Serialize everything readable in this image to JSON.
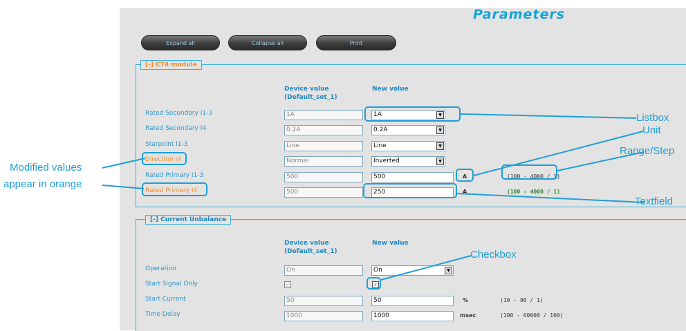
{
  "page": {
    "title": "Parameters"
  },
  "toolbar": {
    "expand_label": "Expand all",
    "collapse_label": "Collapse all",
    "print_label": "Print"
  },
  "sections": [
    {
      "legend": "[-] CT4 module",
      "headers": {
        "device": "Device value\n(Default_set_1)",
        "new": "New value"
      },
      "rows": [
        {
          "label": "Rated Secondary I1-3",
          "device": "1A",
          "new": "1A",
          "type": "select"
        },
        {
          "label": "Rated Secondary I4",
          "device": "0.2A",
          "new": "0.2A",
          "type": "select"
        },
        {
          "label": "Starpoint I1-3",
          "device": "Line",
          "new": "Line",
          "type": "select"
        },
        {
          "label": "Direction I4",
          "device": "Normal",
          "new": "Inverted",
          "type": "select",
          "modified": true
        },
        {
          "label": "Rated Primary I1-3",
          "device": "500",
          "new": "500",
          "type": "text",
          "unit": "A",
          "range": "(100 - 4000 / 1)"
        },
        {
          "label": "Rated Primary I4",
          "device": "500",
          "new": "250",
          "type": "text",
          "unit": "A",
          "range": "(100 - 4000 / 1)",
          "modified": true
        }
      ]
    },
    {
      "legend": "[-] Current Unbalance",
      "headers": {
        "device": "Device value\n(Default_set_1)",
        "new": "New value"
      },
      "rows": [
        {
          "label": "Operation",
          "device": "On",
          "new": "On",
          "type": "select"
        },
        {
          "label": "Start Signal Only",
          "device": "✓",
          "new": "✓",
          "type": "checkbox"
        },
        {
          "label": "Start Current",
          "device": "50",
          "new": "50",
          "type": "text",
          "unit": "%",
          "range": "(10 - 90 / 1)"
        },
        {
          "label": "Time Delay",
          "device": "1000",
          "new": "1000",
          "type": "text",
          "unit": "msec",
          "range": "(100 - 60000 / 100)"
        }
      ]
    }
  ],
  "annotations": {
    "listbox": "Listbox",
    "unit": "Unit",
    "range_step": "Range/Step",
    "textfield": "Textfield",
    "checkbox": "Checkbox",
    "modified_line1": "Modified values",
    "modified_line2": "appear in orange"
  },
  "colors": {
    "accent": "#1e9fd6",
    "modified": "#f28c2e",
    "label": "#2d95c8",
    "panel_bg": "#e3e3e3"
  },
  "icons": {
    "select_arrow": "dropdown-arrow-icon",
    "checkbox_mark": "check-icon"
  }
}
